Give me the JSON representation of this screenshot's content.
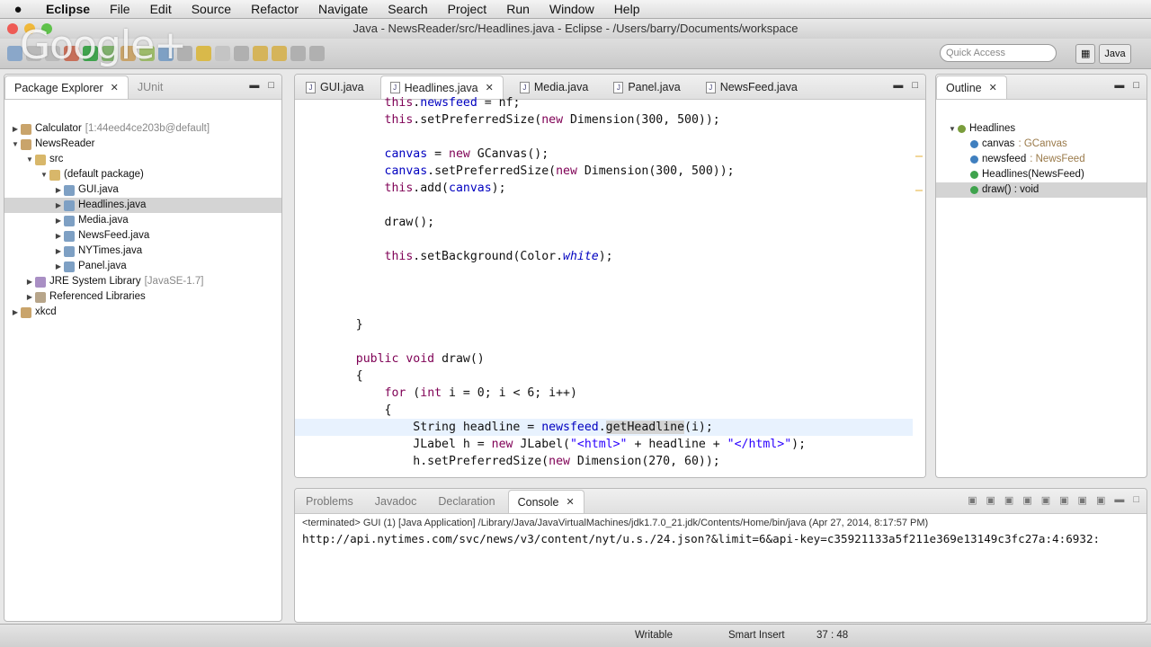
{
  "menubar": {
    "apple": "",
    "items": [
      "Eclipse",
      "File",
      "Edit",
      "Source",
      "Refactor",
      "Navigate",
      "Search",
      "Project",
      "Run",
      "Window",
      "Help"
    ]
  },
  "window": {
    "title": "Java - NewsReader/src/Headlines.java - Eclipse - /Users/barry/Documents/workspace"
  },
  "overlay": {
    "brand": "Google+"
  },
  "toolbar": {
    "quick_access_placeholder": "Quick Access",
    "perspective_label": "Java"
  },
  "package_explorer": {
    "tab_label": "Package Explorer",
    "other_tab_label": "JUnit",
    "tree": [
      {
        "label": "Calculator",
        "suffix": "[1:44eed4ce203b@default]",
        "depth": 0,
        "twisty": "▶"
      },
      {
        "label": "NewsReader",
        "suffix": "",
        "depth": 0,
        "twisty": "▼"
      },
      {
        "label": "src",
        "suffix": "",
        "depth": 1,
        "twisty": "▼"
      },
      {
        "label": "(default package)",
        "suffix": "",
        "depth": 2,
        "twisty": "▼"
      },
      {
        "label": "GUI.java",
        "suffix": "",
        "depth": 3,
        "twisty": "▶"
      },
      {
        "label": "Headlines.java",
        "suffix": "",
        "depth": 3,
        "twisty": "▶"
      },
      {
        "label": "Media.java",
        "suffix": "",
        "depth": 3,
        "twisty": "▶"
      },
      {
        "label": "NewsFeed.java",
        "suffix": "",
        "depth": 3,
        "twisty": "▶"
      },
      {
        "label": "NYTimes.java",
        "suffix": "",
        "depth": 3,
        "twisty": "▶"
      },
      {
        "label": "Panel.java",
        "suffix": "",
        "depth": 3,
        "twisty": "▶"
      },
      {
        "label": "JRE System Library",
        "suffix": "[JavaSE-1.7]",
        "depth": 1,
        "twisty": "▶"
      },
      {
        "label": "Referenced Libraries",
        "suffix": "",
        "depth": 1,
        "twisty": "▶"
      },
      {
        "label": "xkcd",
        "suffix": "",
        "depth": 0,
        "twisty": "▶"
      }
    ]
  },
  "editor": {
    "tabs": [
      "GUI.java",
      "Headlines.java",
      "Media.java",
      "Panel.java",
      "NewsFeed.java"
    ],
    "active_tab": "Headlines.java",
    "lines": [
      "        this.newsfeed = nf;",
      "        this.setPreferredSize(new Dimension(300, 500));",
      "",
      "        canvas = new GCanvas();",
      "        canvas.setPreferredSize(new Dimension(300, 500));",
      "        this.add(canvas);",
      "",
      "        draw();",
      "",
      "        this.setBackground(Color.white);",
      "",
      "",
      "",
      "    }",
      "",
      "    public void draw()",
      "    {",
      "        for (int i = 0; i < 6; i++)",
      "        {",
      "            String headline = newsfeed.getHeadline(i);",
      "            JLabel h = new JLabel(\"<html>\" + headline + \"</html>\");",
      "            h.setPreferredSize(new Dimension(270, 60));"
    ]
  },
  "outline": {
    "tab_label": "Outline",
    "items": [
      {
        "label": "Headlines",
        "type": ""
      },
      {
        "label": "canvas",
        "type": ": GCanvas"
      },
      {
        "label": "newsfeed",
        "type": ": NewsFeed"
      },
      {
        "label": "Headlines(NewsFeed)",
        "type": ""
      },
      {
        "label": "draw() : void",
        "type": ""
      }
    ]
  },
  "console": {
    "tabs": [
      "Problems",
      "Javadoc",
      "Declaration",
      "Console"
    ],
    "active_tab": "Console",
    "status_line": "<terminated> GUI (1) [Java Application] /Library/Java/JavaVirtualMachines/jdk1.7.0_21.jdk/Contents/Home/bin/java (Apr 27, 2014, 8:17:57 PM)",
    "output": "http://api.nytimes.com/svc/news/v3/content/nyt/u.s./24.json?&limit=6&api-key=c35921133a5f211e369e13149c3fc27a:4:6932:"
  },
  "statusbar": {
    "writable": "Writable",
    "insert_mode": "Smart Insert",
    "position": "37 : 48"
  },
  "colors": {
    "keyword": "#7f0055",
    "field": "#0000c0",
    "string": "#2a00ff",
    "selection": "#d4d4d4"
  }
}
